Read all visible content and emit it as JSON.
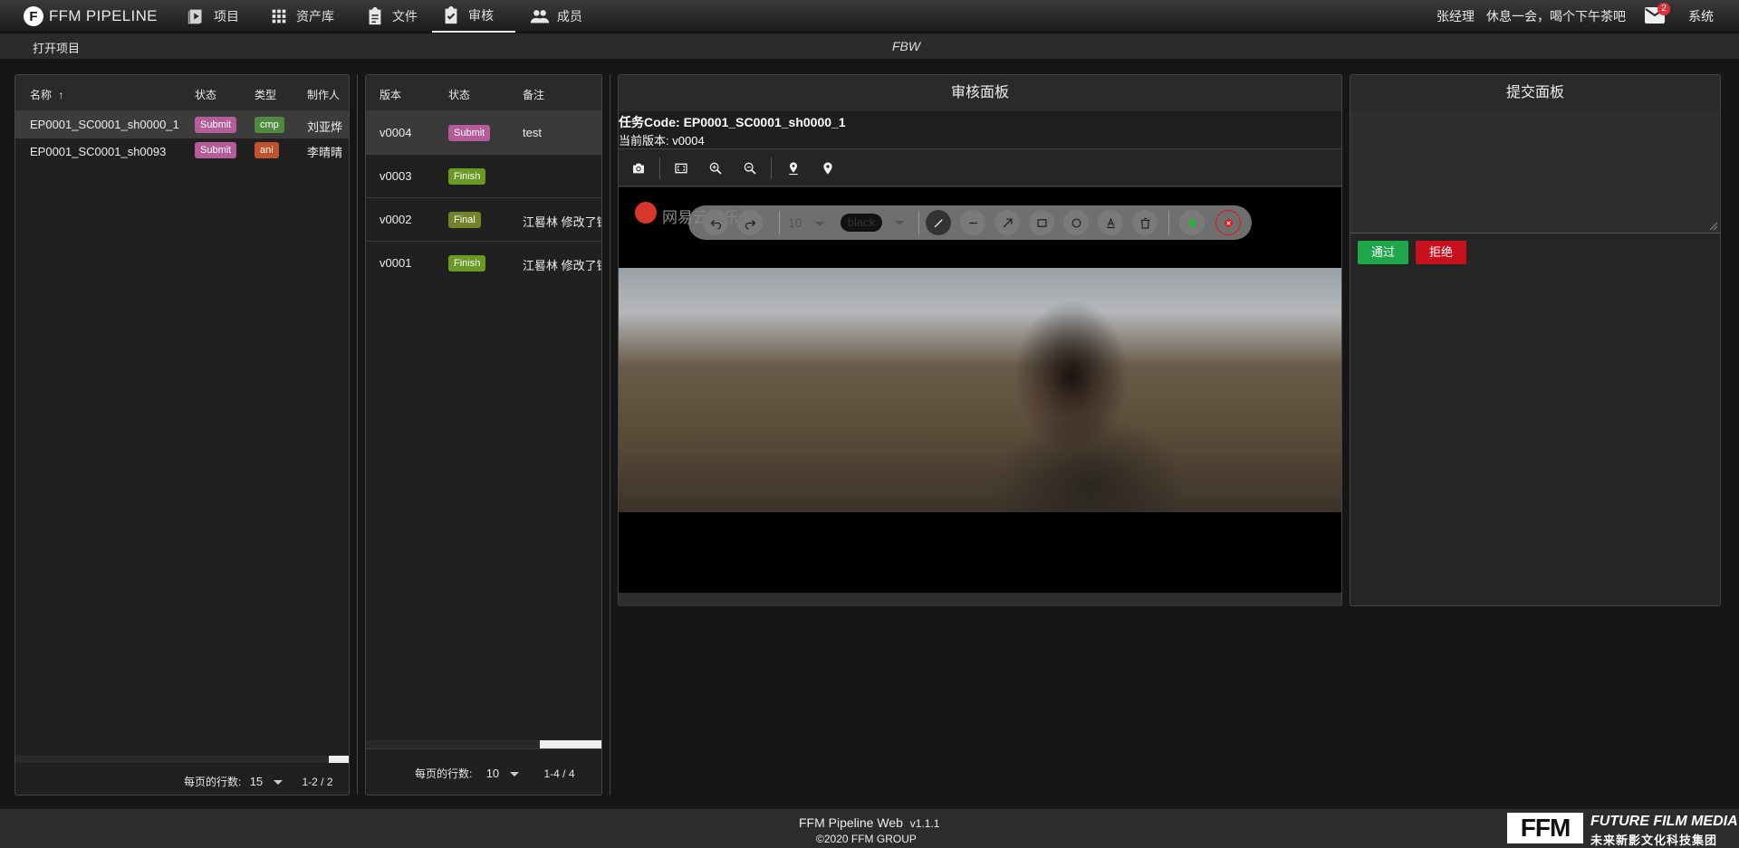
{
  "topbar": {
    "brand": "FFM PIPELINE",
    "brand_logo": "F",
    "nav": [
      {
        "label": "项目",
        "icon": "play-icon"
      },
      {
        "label": "资产库",
        "icon": "grid-icon"
      },
      {
        "label": "文件",
        "icon": "clipboard-icon"
      },
      {
        "label": "审核",
        "icon": "check-clipboard-icon",
        "active": true
      },
      {
        "label": "成员",
        "icon": "people-icon"
      }
    ],
    "user": "张经理",
    "message": "休息一会，喝个下午茶吧",
    "mail_count": "2",
    "system": "系统"
  },
  "subbar": {
    "open_project": "打开项目",
    "project_name": "FBW"
  },
  "tasks": {
    "columns": {
      "name": "名称",
      "status": "状态",
      "type": "类型",
      "artist": "制作人"
    },
    "sort_arrow": "↑",
    "rows": [
      {
        "name": "EP0001_SC0001_sh0000_1",
        "status": "Submit",
        "type": "cmp",
        "artist": "刘亚烨"
      },
      {
        "name": "EP0001_SC0001_sh0093",
        "status": "Submit",
        "type": "ani",
        "artist": "李晴晴"
      }
    ],
    "pagination": {
      "rows_label": "每页的行数:",
      "rows_per_page": "15",
      "range": "1-2 / 2"
    }
  },
  "versions": {
    "columns": {
      "version": "版本",
      "status": "状态",
      "note": "备注"
    },
    "rows": [
      {
        "version": "v0004",
        "status": "Submit",
        "note": "test"
      },
      {
        "version": "v0003",
        "status": "Finish",
        "note": ""
      },
      {
        "version": "v0002",
        "status": "Final",
        "note": "江晷林 修改了镜"
      },
      {
        "version": "v0001",
        "status": "Finish",
        "note": "江晷林 修改了镜"
      }
    ],
    "pagination": {
      "rows_label": "每页的行数:",
      "rows_per_page": "10",
      "range": "1-4 / 4"
    }
  },
  "review": {
    "title": "审核面板",
    "task_code_label": "任务Code:",
    "task_code": "EP0001_SC0001_sh0000_1",
    "current_version_label": "当前版本:",
    "current_version": "v0004",
    "watermark": "网易云音乐",
    "draw": {
      "size": "10",
      "color": "black"
    }
  },
  "submit": {
    "title": "提交面板",
    "approve": "通过",
    "reject": "拒绝"
  },
  "footer": {
    "app": "FFM Pipeline Web",
    "version": "v1.1.1",
    "copyright": "©2020 FFM GROUP",
    "logo_mark": "FFM",
    "logo_en": "FUTURE FILM MEDIA",
    "logo_cn": "未来新影文化科技集团"
  },
  "colors": {
    "submit": "#b75c9a",
    "finish": "#6a9a24",
    "final": "#72832a",
    "cmp": "#4f8b3f",
    "ani": "#c0522c",
    "approve": "#1fa64a",
    "reject": "#c8101e"
  }
}
